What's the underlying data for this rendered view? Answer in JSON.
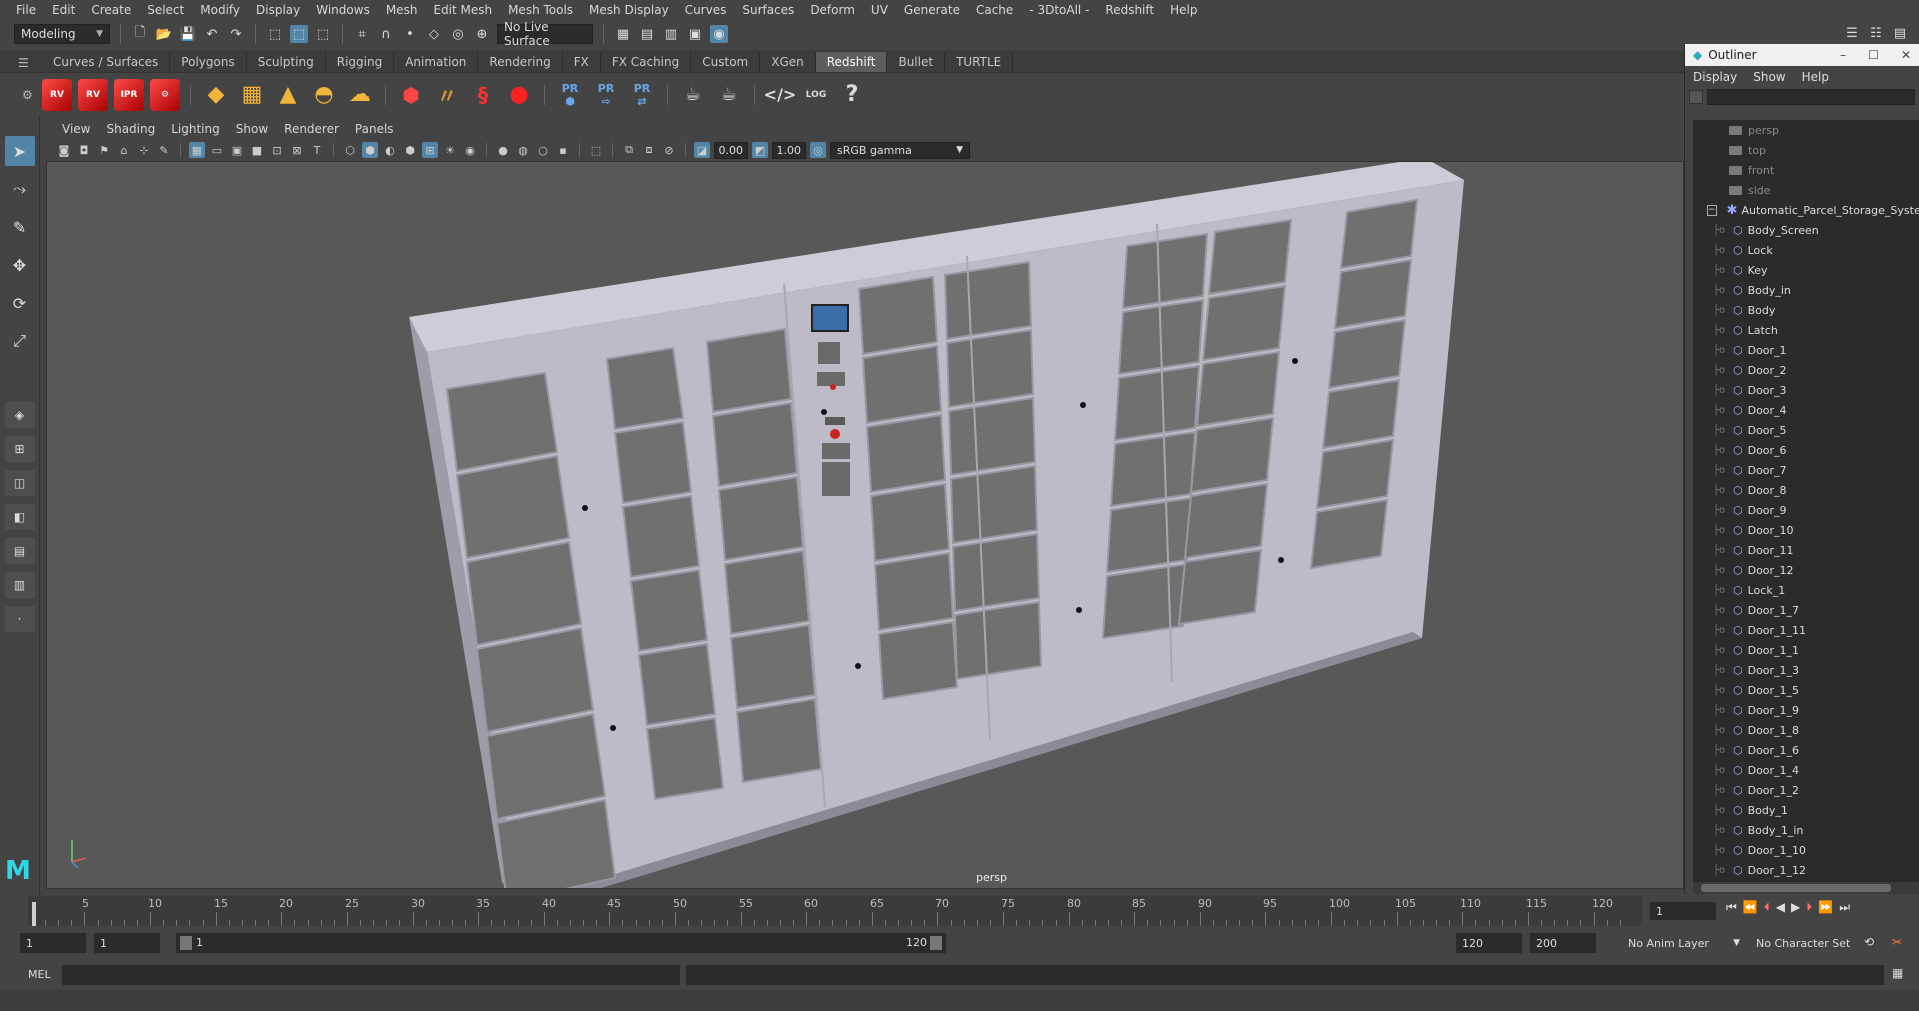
{
  "menubar": [
    "File",
    "Edit",
    "Create",
    "Select",
    "Modify",
    "Display",
    "Windows",
    "Mesh",
    "Edit Mesh",
    "Mesh Tools",
    "Mesh Display",
    "Curves",
    "Surfaces",
    "Deform",
    "UV",
    "Generate",
    "Cache",
    "- 3DtoAll -",
    "Redshift",
    "Help"
  ],
  "status": {
    "mode": "Modeling",
    "live_surface": "No Live Surface"
  },
  "shelf_tabs": [
    "Curves / Surfaces",
    "Polygons",
    "Sculpting",
    "Rigging",
    "Animation",
    "Rendering",
    "FX",
    "FX Caching",
    "Custom",
    "XGen",
    "Redshift",
    "Bullet",
    "TURTLE"
  ],
  "shelf_active": "Redshift",
  "shelf_icons": [
    "RV",
    "RV",
    "IPR",
    "RS",
    "PR",
    "PR",
    "PR",
    "LOG",
    "?"
  ],
  "panel_menu": [
    "View",
    "Shading",
    "Lighting",
    "Show",
    "Renderer",
    "Panels"
  ],
  "panel_tools": {
    "exposure": "0.00",
    "gamma": "1.00",
    "color_space": "sRGB gamma"
  },
  "viewport": {
    "camera": "persp"
  },
  "outliner": {
    "title": "Outliner",
    "menu": [
      "Display",
      "Show",
      "Help"
    ],
    "cameras": [
      "persp",
      "top",
      "front",
      "side"
    ],
    "group": "Automatic_Parcel_Storage_System",
    "children": [
      "Body_Screen",
      "Lock",
      "Key",
      "Body_in",
      "Body",
      "Latch",
      "Door_1",
      "Door_2",
      "Door_3",
      "Door_4",
      "Door_5",
      "Door_6",
      "Door_7",
      "Door_8",
      "Door_9",
      "Door_10",
      "Door_11",
      "Door_12",
      "Lock_1",
      "Door_1_7",
      "Door_1_11",
      "Door_1_1",
      "Door_1_3",
      "Door_1_5",
      "Door_1_9",
      "Door_1_8",
      "Door_1_6",
      "Door_1_4",
      "Door_1_2",
      "Body_1",
      "Body_1_in",
      "Door_1_10",
      "Door_1_12"
    ]
  },
  "timeslider": {
    "ticks": [
      "5",
      "10",
      "15",
      "20",
      "25",
      "30",
      "35",
      "40",
      "45",
      "50",
      "55",
      "60",
      "65",
      "70",
      "75",
      "80",
      "85",
      "90",
      "95",
      "100",
      "105",
      "110",
      "115",
      "120"
    ],
    "current_frame": "1"
  },
  "range": {
    "start": "1",
    "playback_start": "1",
    "slider_start": "1",
    "slider_end": "120",
    "playback_end": "120",
    "end": "200",
    "anim_layer": "No Anim Layer",
    "character_set": "No Character Set"
  },
  "cmd": {
    "label": "MEL"
  },
  "colors": {
    "accent": "#5285a6",
    "viewport_bg": "#585858",
    "locker": "#c6c3cf"
  }
}
